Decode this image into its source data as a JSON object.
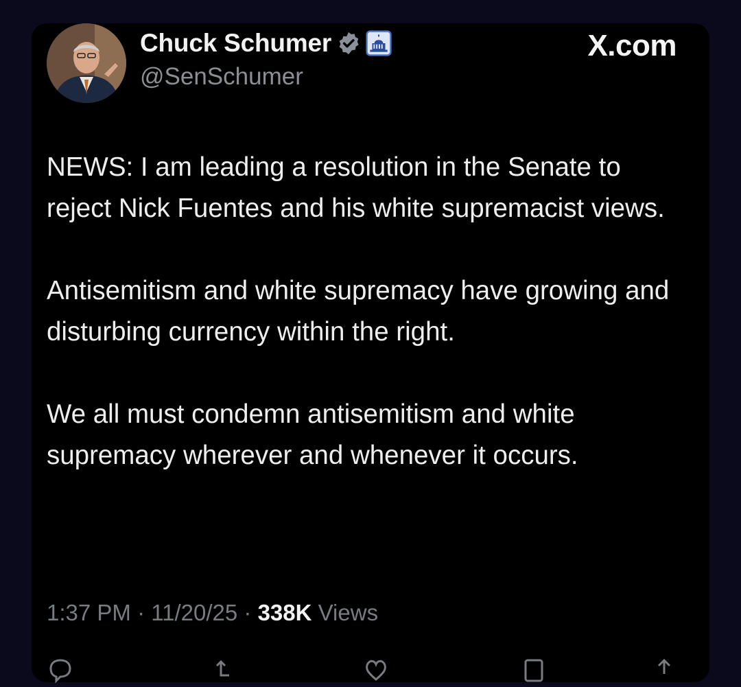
{
  "tweet": {
    "author_name": "Chuck Schumer",
    "handle": "@SenSchumer",
    "site_label": "X.com",
    "paragraphs": [
      "NEWS: I am leading a resolution in the Senate to reject Nick Fuentes and his white supremacist views.",
      "Antisemitism and white supremacy have growing and disturbing currency within the right.",
      "We all must condemn antisemitism and white supremacy wherever and whenever it occurs."
    ],
    "time": "1:37 PM",
    "separator": " · ",
    "date": "11/20/25",
    "views_count": "338K",
    "views_label": " Views"
  },
  "icons": {
    "verified": "verified-badge-icon",
    "affiliation": "capitol-icon",
    "actions": [
      "reply-icon",
      "repost-icon",
      "like-icon",
      "bookmark-icon",
      "share-icon"
    ]
  },
  "colors": {
    "background": "#0b0a1c",
    "card": "#000000",
    "text": "#eeeeee",
    "muted": "#787c80",
    "verified_badge": "#8a8f99"
  }
}
